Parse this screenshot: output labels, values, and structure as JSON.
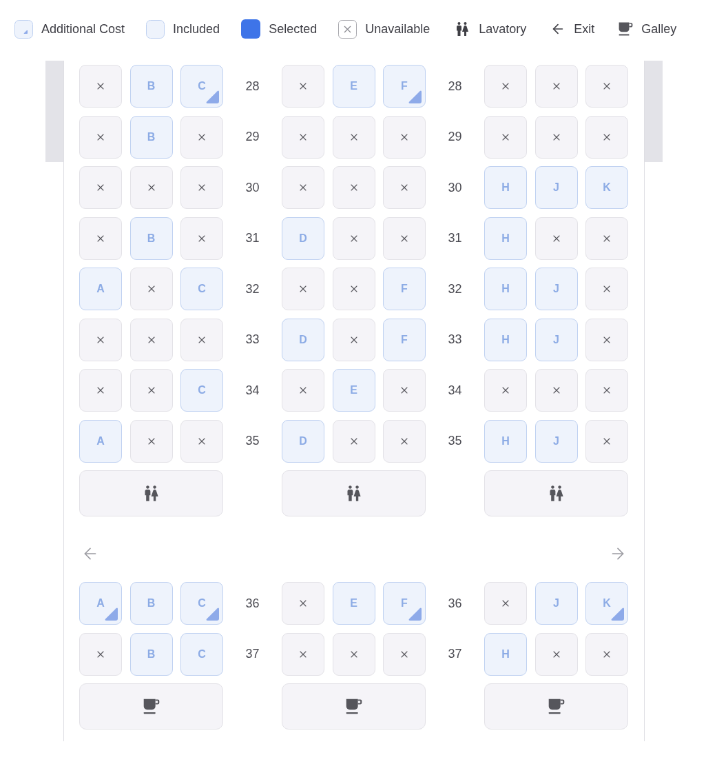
{
  "legend": [
    {
      "kind": "additional_cost",
      "label": "Additional Cost"
    },
    {
      "kind": "included",
      "label": "Included"
    },
    {
      "kind": "selected",
      "label": "Selected"
    },
    {
      "kind": "unavailable",
      "label": "Unavailable"
    },
    {
      "kind": "lavatory",
      "label": "Lavatory"
    },
    {
      "kind": "exit",
      "label": "Exit"
    },
    {
      "kind": "galley",
      "label": "Galley"
    }
  ],
  "cabin": {
    "rows": [
      {
        "kind": "seats",
        "row_numbers": [
          "28",
          "28"
        ],
        "seats": [
          {
            "kind": "unavailable"
          },
          {
            "kind": "included",
            "letter": "B"
          },
          {
            "kind": "additional_cost",
            "letter": "C"
          },
          {
            "kind": "unavailable"
          },
          {
            "kind": "included",
            "letter": "E"
          },
          {
            "kind": "additional_cost",
            "letter": "F"
          },
          {
            "kind": "unavailable"
          },
          {
            "kind": "unavailable"
          },
          {
            "kind": "unavailable"
          }
        ]
      },
      {
        "kind": "seats",
        "row_numbers": [
          "29",
          "29"
        ],
        "seats": [
          {
            "kind": "unavailable"
          },
          {
            "kind": "included",
            "letter": "B"
          },
          {
            "kind": "unavailable"
          },
          {
            "kind": "unavailable"
          },
          {
            "kind": "unavailable"
          },
          {
            "kind": "unavailable"
          },
          {
            "kind": "unavailable"
          },
          {
            "kind": "unavailable"
          },
          {
            "kind": "unavailable"
          }
        ]
      },
      {
        "kind": "seats",
        "row_numbers": [
          "30",
          "30"
        ],
        "seats": [
          {
            "kind": "unavailable"
          },
          {
            "kind": "unavailable"
          },
          {
            "kind": "unavailable"
          },
          {
            "kind": "unavailable"
          },
          {
            "kind": "unavailable"
          },
          {
            "kind": "unavailable"
          },
          {
            "kind": "included",
            "letter": "H"
          },
          {
            "kind": "included",
            "letter": "J"
          },
          {
            "kind": "included",
            "letter": "K"
          }
        ]
      },
      {
        "kind": "seats",
        "row_numbers": [
          "31",
          "31"
        ],
        "seats": [
          {
            "kind": "unavailable"
          },
          {
            "kind": "included",
            "letter": "B"
          },
          {
            "kind": "unavailable"
          },
          {
            "kind": "included",
            "letter": "D"
          },
          {
            "kind": "unavailable"
          },
          {
            "kind": "unavailable"
          },
          {
            "kind": "included",
            "letter": "H"
          },
          {
            "kind": "unavailable"
          },
          {
            "kind": "unavailable"
          }
        ]
      },
      {
        "kind": "seats",
        "row_numbers": [
          "32",
          "32"
        ],
        "seats": [
          {
            "kind": "included",
            "letter": "A"
          },
          {
            "kind": "unavailable"
          },
          {
            "kind": "included",
            "letter": "C"
          },
          {
            "kind": "unavailable"
          },
          {
            "kind": "unavailable"
          },
          {
            "kind": "included",
            "letter": "F"
          },
          {
            "kind": "included",
            "letter": "H"
          },
          {
            "kind": "included",
            "letter": "J"
          },
          {
            "kind": "unavailable"
          }
        ]
      },
      {
        "kind": "seats",
        "row_numbers": [
          "33",
          "33"
        ],
        "seats": [
          {
            "kind": "unavailable"
          },
          {
            "kind": "unavailable"
          },
          {
            "kind": "unavailable"
          },
          {
            "kind": "included",
            "letter": "D"
          },
          {
            "kind": "unavailable"
          },
          {
            "kind": "included",
            "letter": "F"
          },
          {
            "kind": "included",
            "letter": "H"
          },
          {
            "kind": "included",
            "letter": "J"
          },
          {
            "kind": "unavailable"
          }
        ]
      },
      {
        "kind": "seats",
        "row_numbers": [
          "34",
          "34"
        ],
        "seats": [
          {
            "kind": "unavailable"
          },
          {
            "kind": "unavailable"
          },
          {
            "kind": "included",
            "letter": "C"
          },
          {
            "kind": "unavailable"
          },
          {
            "kind": "included",
            "letter": "E"
          },
          {
            "kind": "unavailable"
          },
          {
            "kind": "unavailable"
          },
          {
            "kind": "unavailable"
          },
          {
            "kind": "unavailable"
          }
        ]
      },
      {
        "kind": "seats",
        "row_numbers": [
          "35",
          "35"
        ],
        "seats": [
          {
            "kind": "included",
            "letter": "A"
          },
          {
            "kind": "unavailable"
          },
          {
            "kind": "unavailable"
          },
          {
            "kind": "included",
            "letter": "D"
          },
          {
            "kind": "unavailable"
          },
          {
            "kind": "unavailable"
          },
          {
            "kind": "included",
            "letter": "H"
          },
          {
            "kind": "included",
            "letter": "J"
          },
          {
            "kind": "unavailable"
          }
        ]
      },
      {
        "kind": "facilities",
        "units": [
          {
            "kind": "lavatory"
          },
          {
            "kind": "lavatory"
          },
          {
            "kind": "lavatory"
          }
        ]
      },
      {
        "kind": "exits",
        "exits": [
          {
            "kind": "left"
          },
          {
            "kind": "right"
          }
        ]
      },
      {
        "kind": "seats",
        "row_numbers": [
          "36",
          "36"
        ],
        "seats": [
          {
            "kind": "additional_cost",
            "letter": "A"
          },
          {
            "kind": "included",
            "letter": "B"
          },
          {
            "kind": "additional_cost",
            "letter": "C"
          },
          {
            "kind": "unavailable"
          },
          {
            "kind": "included",
            "letter": "E"
          },
          {
            "kind": "additional_cost",
            "letter": "F"
          },
          {
            "kind": "unavailable"
          },
          {
            "kind": "included",
            "letter": "J"
          },
          {
            "kind": "additional_cost",
            "letter": "K"
          }
        ]
      },
      {
        "kind": "seats",
        "row_numbers": [
          "37",
          "37"
        ],
        "seats": [
          {
            "kind": "unavailable"
          },
          {
            "kind": "included",
            "letter": "B"
          },
          {
            "kind": "included",
            "letter": "C"
          },
          {
            "kind": "unavailable"
          },
          {
            "kind": "unavailable"
          },
          {
            "kind": "unavailable"
          },
          {
            "kind": "included",
            "letter": "H"
          },
          {
            "kind": "unavailable"
          },
          {
            "kind": "unavailable"
          }
        ]
      },
      {
        "kind": "facilities",
        "units": [
          {
            "kind": "galley"
          },
          {
            "kind": "galley"
          },
          {
            "kind": "galley"
          }
        ]
      }
    ]
  }
}
